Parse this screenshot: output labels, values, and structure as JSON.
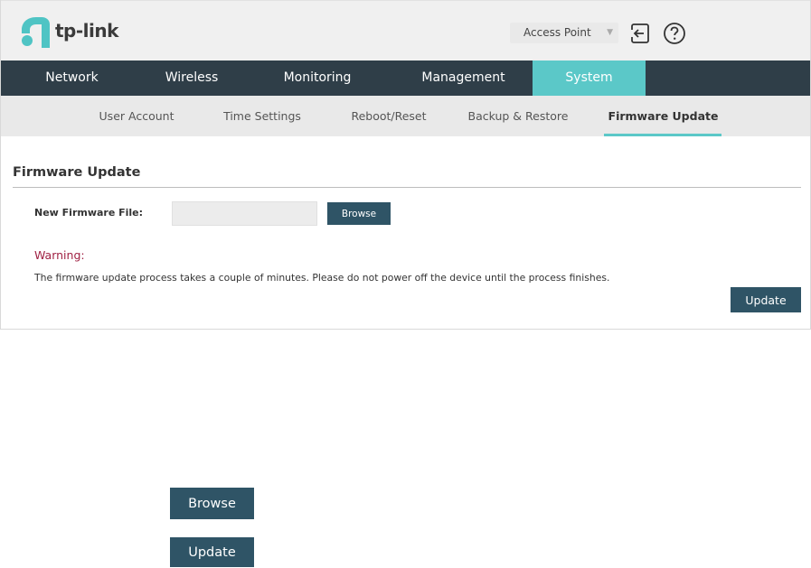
{
  "brand": {
    "name": "tp-link",
    "color": "#5bc8c8"
  },
  "header": {
    "mode_select": "Access Point",
    "icons": [
      "logout-icon",
      "help-icon"
    ]
  },
  "main_nav": {
    "tabs": [
      {
        "label": "Network"
      },
      {
        "label": "Wireless"
      },
      {
        "label": "Monitoring"
      },
      {
        "label": "Management"
      },
      {
        "label": "System",
        "active": true
      }
    ],
    "active_color": "#5bc8c8",
    "bg_color": "#2f3e48"
  },
  "sub_nav": {
    "tabs": [
      {
        "label": "User Account"
      },
      {
        "label": "Time Settings"
      },
      {
        "label": "Reboot/Reset"
      },
      {
        "label": "Backup & Restore"
      },
      {
        "label": "Firmware Update",
        "active": true
      }
    ]
  },
  "content": {
    "section_title": "Firmware Update",
    "field_label": "New Firmware File:",
    "file_value": "",
    "browse_label": "Browse",
    "warning_label": "Warning:",
    "warning_text": "The firmware update process takes a couple of minutes. Please do not power off the device until the process finishes.",
    "update_label": "Update"
  },
  "legend": {
    "browse_label": "Browse",
    "update_label": "Update"
  }
}
